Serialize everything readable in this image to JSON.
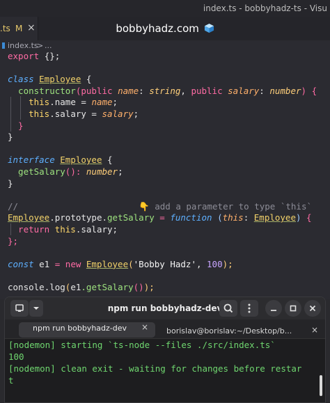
{
  "window": {
    "title": "index.ts - bobbyhadz-ts - Visu"
  },
  "tab": {
    "label": ".ts",
    "modified": "M",
    "close": "×"
  },
  "overlay": {
    "title": "bobbyhadz.com"
  },
  "breadcrumb": {
    "file": "index.ts",
    "separator": ">",
    "rest": "..."
  },
  "code_lines": [
    [
      [
        "export ",
        "t-kw"
      ],
      [
        "{};",
        "t-punc"
      ]
    ],
    [],
    [
      [
        "class ",
        "t-kwi"
      ],
      [
        "Employee",
        "t-class"
      ],
      [
        " {",
        "t-punc"
      ]
    ],
    [
      [
        "  constructor",
        "t-fn"
      ],
      [
        "(",
        "t-paren1"
      ],
      [
        "public ",
        "t-kw"
      ],
      [
        "name",
        "t-param"
      ],
      [
        ": ",
        "t-punc"
      ],
      [
        "string",
        "t-type"
      ],
      [
        ", ",
        "t-punc"
      ],
      [
        "public ",
        "t-kw"
      ],
      [
        "salary",
        "t-param"
      ],
      [
        ": ",
        "t-punc"
      ],
      [
        "number",
        "t-type"
      ],
      [
        ") ",
        "t-paren1"
      ],
      [
        "{",
        "t-paren1"
      ]
    ],
    [
      [
        "    this",
        "t-this"
      ],
      [
        ".name = ",
        "t-punc"
      ],
      [
        "name",
        "t-param"
      ],
      [
        ";",
        "t-punc"
      ]
    ],
    [
      [
        "    this",
        "t-this"
      ],
      [
        ".salary = ",
        "t-punc"
      ],
      [
        "salary",
        "t-param"
      ],
      [
        ";",
        "t-punc"
      ]
    ],
    [
      [
        "  }",
        "t-paren1"
      ]
    ],
    [
      [
        "}",
        "t-punc"
      ]
    ],
    [],
    [
      [
        "interface ",
        "t-kwi"
      ],
      [
        "Employee",
        "t-class"
      ],
      [
        " {",
        "t-punc"
      ]
    ],
    [
      [
        "  getSalary",
        "t-fn"
      ],
      [
        "(): ",
        "t-paren1"
      ],
      [
        "number",
        "t-type"
      ],
      [
        ";",
        "t-punc"
      ]
    ],
    [
      [
        "}",
        "t-punc"
      ]
    ],
    [],
    [
      [
        "//",
        "t-comment"
      ],
      [
        "                       👇 add a parameter to type `this`",
        "t-comment"
      ]
    ],
    [
      [
        "Employee",
        "t-class"
      ],
      [
        ".prototype.",
        "t-punc"
      ],
      [
        "getSalary",
        "t-fn"
      ],
      [
        " = ",
        "t-kw"
      ],
      [
        "function ",
        "t-kwi"
      ],
      [
        "(",
        "t-paren2"
      ],
      [
        "this",
        "t-param"
      ],
      [
        ": ",
        "t-punc"
      ],
      [
        "Employee",
        "t-class"
      ],
      [
        ") ",
        "t-paren2"
      ],
      [
        "{",
        "t-paren1"
      ]
    ],
    [
      [
        "  return ",
        "t-kw"
      ],
      [
        "this",
        "t-this"
      ],
      [
        ".salary;",
        "t-punc"
      ]
    ],
    [
      [
        "};",
        "t-paren1"
      ]
    ],
    [],
    [
      [
        "const ",
        "t-kwi"
      ],
      [
        "e1",
        "t-punc"
      ],
      [
        " = ",
        "t-kw"
      ],
      [
        "new ",
        "t-kw"
      ],
      [
        "Employee",
        "t-class"
      ],
      [
        "(",
        "t-paren3"
      ],
      [
        "'Bobby Hadz'",
        "t-str"
      ],
      [
        ", ",
        "t-punc"
      ],
      [
        "100",
        "t-num"
      ],
      [
        ");",
        "t-paren3"
      ]
    ],
    [],
    [
      [
        "console",
        "t-punc"
      ],
      [
        ".log",
        "t-punc"
      ],
      [
        "(",
        "t-paren3"
      ],
      [
        "e1",
        "t-punc"
      ],
      [
        ".getSalary",
        "t-fn"
      ],
      [
        "()",
        "t-paren1"
      ],
      [
        ");",
        "t-paren3"
      ]
    ]
  ],
  "terminal": {
    "title": "npm run bobbyhadz-dev",
    "tabs": [
      {
        "label": "npm run bobbyhadz-dev",
        "close": "×"
      },
      {
        "label": "borislav@borislav:~/Desktop/b...",
        "close": "×"
      }
    ],
    "output": [
      "[nodemon] starting `ts-node --files ./src/index.ts`",
      "100",
      "[nodemon] clean exit - waiting for changes before restar",
      "t"
    ]
  },
  "icons": [
    "new-tab-icon",
    "dropdown-chevron-icon",
    "search-icon",
    "menu-icon",
    "minimize-icon",
    "maximize-icon",
    "close-icon",
    "cube-icon"
  ],
  "colors": {
    "editor_bg": "#2b2b31",
    "terminal_bg": "#1d1d1f",
    "terminal_text": "#6fd66f",
    "keyword": "#ff6ba4",
    "class_name": "#f3d36a"
  }
}
